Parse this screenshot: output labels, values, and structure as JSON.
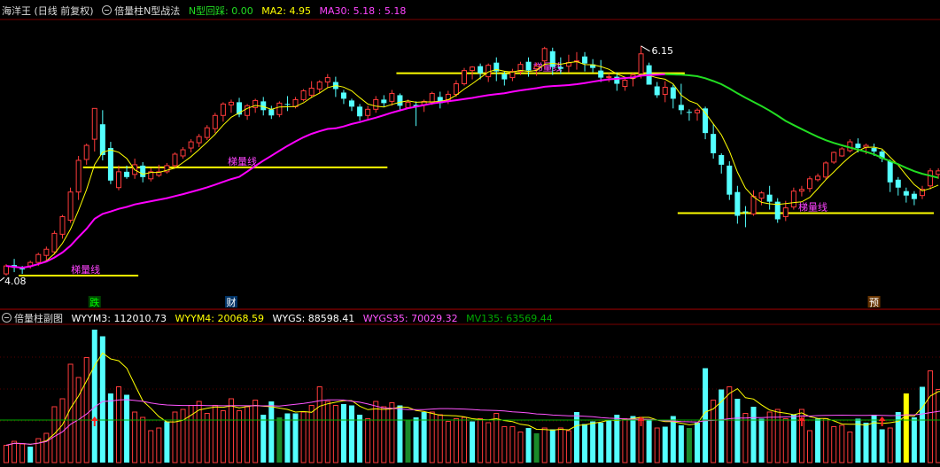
{
  "main": {
    "stock_label": "海洋王 (日线 前复权)",
    "indicator_name": "倍量柱N型战法",
    "n_label": "N型回踩: 0.00",
    "ma2_label": "MA2: 4.95",
    "ma30_label": "MA30: 5.18 : 5.18",
    "high_price": "6.15",
    "low_price": "4.08",
    "ladder_label": "梯量线",
    "colors": {
      "up": "#ff3b3b",
      "down": "#54ffff",
      "ma2": "#ffff00",
      "ma30": "#ff00ff",
      "ma30_green": "#22dd22",
      "ladder": "#ffff00",
      "ladder_text": "#ff44ff"
    },
    "markers": [
      {
        "text": "跌",
        "color": "#00ff00",
        "bg": "#004400"
      },
      {
        "text": "财",
        "color": "#ffffff",
        "bg": "#003366"
      },
      {
        "text": "预",
        "color": "#ffffff",
        "bg": "#663300"
      }
    ]
  },
  "sub": {
    "indicator_name": "倍量柱副图",
    "wyym3": "WYYM3: 112010.73",
    "wyym4": "WYYM4: 20068.59",
    "wygs": "WYGS: 88598.41",
    "wygs35": "WYGS35: 70029.32",
    "mv135": "MV135: 63569.44",
    "colors": {
      "wyym3": "#ffffff",
      "wyym4": "#ffff00",
      "wygs": "#ffffff",
      "wygs35": "#ff55ff",
      "mv135": "#00aa00",
      "arrow": "#ff2222"
    }
  },
  "chart_data": {
    "type": "candlestick",
    "candles": [
      [
        4.12,
        4.21,
        4.1,
        4.23
      ],
      [
        4.22,
        4.19,
        4.14,
        4.29
      ],
      [
        4.18,
        4.17,
        4.12,
        4.21
      ],
      [
        4.21,
        4.25,
        4.18,
        4.27
      ],
      [
        4.25,
        4.34,
        4.21,
        4.36
      ],
      [
        4.33,
        4.4,
        4.27,
        4.43
      ],
      [
        4.37,
        4.58,
        4.34,
        4.61
      ],
      [
        4.57,
        4.77,
        4.52,
        4.79
      ],
      [
        4.73,
        5.05,
        4.7,
        5.1
      ],
      [
        5.05,
        5.41,
        4.96,
        5.46
      ],
      [
        5.42,
        5.58,
        5.36,
        5.6
      ],
      [
        5.65,
        6.0,
        5.51,
        6.0
      ],
      [
        5.82,
        5.47,
        5.41,
        5.98
      ],
      [
        5.55,
        5.18,
        5.14,
        5.62
      ],
      [
        5.1,
        5.28,
        5.07,
        5.35
      ],
      [
        5.28,
        5.22,
        5.2,
        5.35
      ],
      [
        5.25,
        5.36,
        5.2,
        5.43
      ],
      [
        5.35,
        5.22,
        5.16,
        5.39
      ],
      [
        5.2,
        5.28,
        5.17,
        5.32
      ],
      [
        5.24,
        5.28,
        5.22,
        5.36
      ],
      [
        5.28,
        5.35,
        5.26,
        5.38
      ],
      [
        5.35,
        5.48,
        5.32,
        5.5
      ],
      [
        5.46,
        5.53,
        5.43,
        5.56
      ],
      [
        5.55,
        5.62,
        5.5,
        5.65
      ],
      [
        5.61,
        5.68,
        5.56,
        5.71
      ],
      [
        5.67,
        5.78,
        5.64,
        5.81
      ],
      [
        5.77,
        5.92,
        5.72,
        5.95
      ],
      [
        5.92,
        6.05,
        5.85,
        6.07
      ],
      [
        6.04,
        6.07,
        5.95,
        6.1
      ],
      [
        6.07,
        5.93,
        5.9,
        6.12
      ],
      [
        5.92,
        6.03,
        5.87,
        6.05
      ],
      [
        6.01,
        6.09,
        5.95,
        6.11
      ],
      [
        6.08,
        5.98,
        5.92,
        6.13
      ],
      [
        5.99,
        5.92,
        5.88,
        6.03
      ],
      [
        5.93,
        6.06,
        5.9,
        6.08
      ],
      [
        6.05,
        6.04,
        5.97,
        6.14
      ],
      [
        6.02,
        6.1,
        6.0,
        6.13
      ],
      [
        6.1,
        6.2,
        6.08,
        6.22
      ],
      [
        6.15,
        6.23,
        6.12,
        6.31
      ],
      [
        6.22,
        6.3,
        6.17,
        6.32
      ],
      [
        6.3,
        6.35,
        6.24,
        6.39
      ],
      [
        6.3,
        6.22,
        6.13,
        6.36
      ],
      [
        6.18,
        6.11,
        6.05,
        6.21
      ],
      [
        6.09,
        6.02,
        5.97,
        6.11
      ],
      [
        6.02,
        5.91,
        5.86,
        6.05
      ],
      [
        5.92,
        5.99,
        5.86,
        6.03
      ],
      [
        5.99,
        6.1,
        5.95,
        6.14
      ],
      [
        6.1,
        6.06,
        6.02,
        6.15
      ],
      [
        6.08,
        6.17,
        6.03,
        6.21
      ],
      [
        6.15,
        6.03,
        5.97,
        6.17
      ],
      [
        6.01,
        6.07,
        6.0,
        6.1
      ],
      [
        6.04,
        6.02,
        5.8,
        6.08
      ],
      [
        6.04,
        6.08,
        5.96,
        6.1
      ],
      [
        6.07,
        6.17,
        6.04,
        6.19
      ],
      [
        6.13,
        6.06,
        6.0,
        6.19
      ],
      [
        6.1,
        6.16,
        6.05,
        6.2
      ],
      [
        6.16,
        6.28,
        6.13,
        6.32
      ],
      [
        6.28,
        6.43,
        6.26,
        6.46
      ],
      [
        6.43,
        6.47,
        6.33,
        6.48
      ],
      [
        6.48,
        6.4,
        6.33,
        6.51
      ],
      [
        6.36,
        6.49,
        6.3,
        6.51
      ],
      [
        6.52,
        6.42,
        6.31,
        6.58
      ],
      [
        6.39,
        6.33,
        6.26,
        6.42
      ],
      [
        6.35,
        6.42,
        6.31,
        6.45
      ],
      [
        6.42,
        6.5,
        6.38,
        6.53
      ],
      [
        6.53,
        6.43,
        6.36,
        6.58
      ],
      [
        6.45,
        6.48,
        6.37,
        6.52
      ],
      [
        6.54,
        6.68,
        6.46,
        6.7
      ],
      [
        6.65,
        6.47,
        6.38,
        6.69
      ],
      [
        6.47,
        6.45,
        6.39,
        6.58
      ],
      [
        6.48,
        6.52,
        6.41,
        6.61
      ],
      [
        6.53,
        6.54,
        6.44,
        6.64
      ],
      [
        6.59,
        6.51,
        6.42,
        6.64
      ],
      [
        6.5,
        6.46,
        6.41,
        6.56
      ],
      [
        6.43,
        6.35,
        6.3,
        6.55
      ],
      [
        6.35,
        6.36,
        6.3,
        6.4
      ],
      [
        6.36,
        6.28,
        6.2,
        6.41
      ],
      [
        6.25,
        6.32,
        6.2,
        6.35
      ],
      [
        6.34,
        6.38,
        6.25,
        6.4
      ],
      [
        6.39,
        6.62,
        6.34,
        6.71
      ],
      [
        6.49,
        6.27,
        6.27,
        6.52
      ],
      [
        6.25,
        6.15,
        6.12,
        6.3
      ],
      [
        6.16,
        6.24,
        6.07,
        6.31
      ],
      [
        6.24,
        6.11,
        6.0,
        6.27
      ],
      [
        6.04,
        5.98,
        5.93,
        6.28
      ],
      [
        5.96,
        5.95,
        5.86,
        5.99
      ],
      [
        5.95,
        5.98,
        5.86,
        6.0
      ],
      [
        6.0,
        5.72,
        5.65,
        6.02
      ],
      [
        5.71,
        5.49,
        5.43,
        5.82
      ],
      [
        5.47,
        5.36,
        5.26,
        5.49
      ],
      [
        5.35,
        5.02,
        4.96,
        5.4
      ],
      [
        5.05,
        4.78,
        4.69,
        5.12
      ],
      [
        4.83,
        4.82,
        4.65,
        4.89
      ],
      [
        4.8,
        5.0,
        4.78,
        5.07
      ],
      [
        4.98,
        5.04,
        4.9,
        5.06
      ],
      [
        5.02,
        4.94,
        4.85,
        5.12
      ],
      [
        4.94,
        4.74,
        4.7,
        4.98
      ],
      [
        4.77,
        4.87,
        4.72,
        4.95
      ],
      [
        4.88,
        5.06,
        4.85,
        5.1
      ],
      [
        5.06,
        5.08,
        5.0,
        5.12
      ],
      [
        5.09,
        5.2,
        5.05,
        5.23
      ],
      [
        5.19,
        5.23,
        5.17,
        5.26
      ],
      [
        5.22,
        5.38,
        5.19,
        5.4
      ],
      [
        5.39,
        5.5,
        5.37,
        5.51
      ],
      [
        5.46,
        5.54,
        5.45,
        5.56
      ],
      [
        5.52,
        5.62,
        5.5,
        5.65
      ],
      [
        5.6,
        5.55,
        5.5,
        5.66
      ],
      [
        5.56,
        5.58,
        5.48,
        5.6
      ],
      [
        5.55,
        5.51,
        5.46,
        5.6
      ],
      [
        5.51,
        5.43,
        5.39,
        5.53
      ],
      [
        5.4,
        5.16,
        5.05,
        5.42
      ],
      [
        5.19,
        5.1,
        5.01,
        5.22
      ],
      [
        5.06,
        5.01,
        4.93,
        5.1
      ],
      [
        5.03,
        4.97,
        4.9,
        5.06
      ],
      [
        5.01,
        5.08,
        4.97,
        5.12
      ],
      [
        5.12,
        5.29,
        5.08,
        5.32
      ],
      [
        5.25,
        5.29,
        5.2,
        5.32
      ]
    ],
    "ladder_lines": [
      [
        2,
        16,
        4.1
      ],
      [
        10,
        47,
        5.33
      ],
      [
        49,
        84,
        6.4
      ],
      [
        84,
        115,
        4.81
      ]
    ],
    "volume_bars": [
      [
        0.13,
        0
      ],
      [
        0.16,
        0
      ],
      [
        0.14,
        0
      ],
      [
        0.12,
        1
      ],
      [
        0.18,
        0
      ],
      [
        0.22,
        0
      ],
      [
        0.42,
        0
      ],
      [
        0.48,
        0
      ],
      [
        0.74,
        0
      ],
      [
        0.64,
        0
      ],
      [
        0.79,
        0
      ],
      [
        1.0,
        1
      ],
      [
        0.95,
        1
      ],
      [
        0.52,
        1
      ],
      [
        0.57,
        0
      ],
      [
        0.51,
        1
      ],
      [
        0.38,
        0
      ],
      [
        0.34,
        0
      ],
      [
        0.24,
        0
      ],
      [
        0.26,
        0
      ],
      [
        0.31,
        1
      ],
      [
        0.38,
        0
      ],
      [
        0.4,
        0
      ],
      [
        0.43,
        0
      ],
      [
        0.46,
        0
      ],
      [
        0.37,
        0
      ],
      [
        0.43,
        0
      ],
      [
        0.39,
        0
      ],
      [
        0.48,
        0
      ],
      [
        0.39,
        0
      ],
      [
        0.42,
        0
      ],
      [
        0.47,
        0
      ],
      [
        0.36,
        1
      ],
      [
        0.46,
        1
      ],
      [
        0.34,
        2
      ],
      [
        0.37,
        1
      ],
      [
        0.37,
        1
      ],
      [
        0.38,
        0
      ],
      [
        0.43,
        0
      ],
      [
        0.57,
        0
      ],
      [
        0.46,
        0
      ],
      [
        0.43,
        0
      ],
      [
        0.44,
        1
      ],
      [
        0.43,
        1
      ],
      [
        0.36,
        1
      ],
      [
        0.33,
        0
      ],
      [
        0.46,
        0
      ],
      [
        0.42,
        0
      ],
      [
        0.45,
        0
      ],
      [
        0.43,
        1
      ],
      [
        0.32,
        2
      ],
      [
        0.34,
        1
      ],
      [
        0.38,
        1
      ],
      [
        0.38,
        0
      ],
      [
        0.36,
        0
      ],
      [
        0.31,
        0
      ],
      [
        0.33,
        0
      ],
      [
        0.34,
        0
      ],
      [
        0.31,
        1
      ],
      [
        0.33,
        0
      ],
      [
        0.3,
        0
      ],
      [
        0.37,
        0
      ],
      [
        0.27,
        0
      ],
      [
        0.27,
        0
      ],
      [
        0.23,
        0
      ],
      [
        0.26,
        1
      ],
      [
        0.22,
        2
      ],
      [
        0.26,
        0
      ],
      [
        0.25,
        1
      ],
      [
        0.26,
        0
      ],
      [
        0.24,
        0
      ],
      [
        0.38,
        1
      ],
      [
        0.29,
        1
      ],
      [
        0.31,
        1
      ],
      [
        0.3,
        1
      ],
      [
        0.32,
        1
      ],
      [
        0.36,
        1
      ],
      [
        0.33,
        0
      ],
      [
        0.35,
        1
      ],
      [
        0.34,
        0
      ],
      [
        0.32,
        1
      ],
      [
        0.26,
        0
      ],
      [
        0.27,
        1
      ],
      [
        0.35,
        1
      ],
      [
        0.28,
        1
      ],
      [
        0.26,
        2
      ],
      [
        0.3,
        1
      ],
      [
        0.71,
        1
      ],
      [
        0.47,
        0
      ],
      [
        0.55,
        1
      ],
      [
        0.57,
        0
      ],
      [
        0.48,
        1
      ],
      [
        0.37,
        0
      ],
      [
        0.42,
        1
      ],
      [
        0.33,
        1
      ],
      [
        0.38,
        0
      ],
      [
        0.4,
        0
      ],
      [
        0.33,
        0
      ],
      [
        0.36,
        1
      ],
      [
        0.4,
        0
      ],
      [
        0.24,
        0
      ],
      [
        0.33,
        1
      ],
      [
        0.33,
        0
      ],
      [
        0.27,
        0
      ],
      [
        0.28,
        0
      ],
      [
        0.23,
        0
      ],
      [
        0.33,
        1
      ],
      [
        0.3,
        1
      ],
      [
        0.36,
        1
      ],
      [
        0.25,
        1
      ],
      [
        0.26,
        0
      ],
      [
        0.38,
        1
      ],
      [
        0.52,
        3
      ],
      [
        0.34,
        1
      ],
      [
        0.57,
        1
      ],
      [
        0.69,
        0
      ],
      [
        0.55,
        0
      ],
      [
        0.55,
        0
      ]
    ],
    "arrows": [
      11,
      79,
      99,
      109,
      119
    ]
  }
}
